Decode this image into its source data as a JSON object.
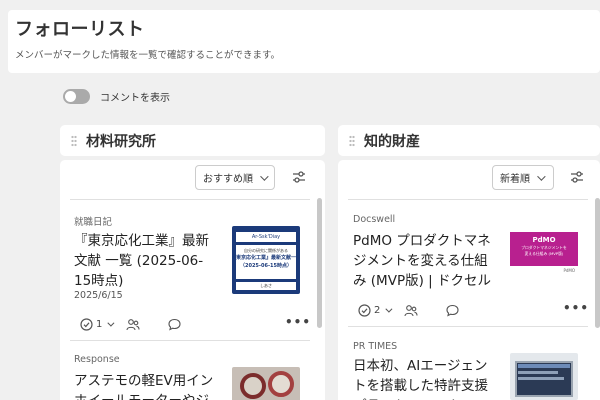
{
  "header": {
    "title": "フォローリスト",
    "description": "メンバーがマークした情報を一覧で確認することができます。"
  },
  "comment_toggle": {
    "label": "コメントを表示",
    "on": false
  },
  "columns": [
    {
      "name": "材料研究所",
      "sort_label": "おすすめ順",
      "cards": [
        {
          "source": "就職日記",
          "title": "『東京応化工業』最新文献 一覧 (2025-06-15時点)",
          "date": "2025/6/15",
          "like_count": "1",
          "thumb_header": "Ar-Ssk'Diay",
          "thumb_lines": [
            "自分の研究に関係がある",
            "東京応化工業』最新文献一",
            "（2025-06-15時点）"
          ],
          "thumb_footer": "しあさ"
        },
        {
          "source": "Response",
          "title": "アステモの軽EV用インホイールモーターやジ"
        }
      ]
    },
    {
      "name": "知的財産",
      "sort_label": "新着順",
      "cards": [
        {
          "source": "Docswell",
          "title": "PdMO プロダクトマネジメントを変える仕組み (MVP版) | ドクセル",
          "like_count": "2",
          "thumb_header": "PdMO",
          "thumb_lines": [
            "プロダクトマネジメントを",
            "変える仕組み (MVP版)"
          ],
          "thumb_footer": "PdMO"
        },
        {
          "source": "PR TIMES",
          "title": "日本初、AIエージェントを搭載した特許支援プラットフォーム"
        }
      ]
    }
  ],
  "colors": {
    "background": "#f0f0f0",
    "panel": "#ffffff",
    "toggle_off": "#aaaaaa",
    "thumb_navy": "#1b3a7a",
    "thumb_magenta": "#b8208f"
  },
  "icons": [
    "chevron-down-icon",
    "filter-settings-icon",
    "check-circle-icon",
    "users-icon",
    "comment-icon",
    "more-icon"
  ]
}
